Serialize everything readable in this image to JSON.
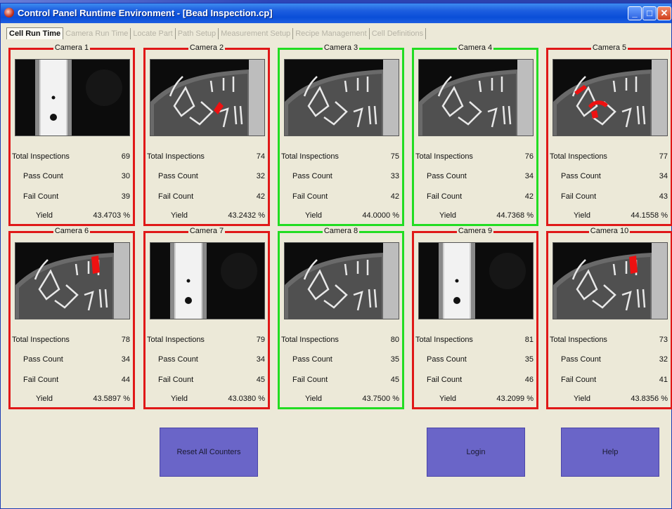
{
  "window": {
    "title": "Control Panel Runtime Environment - [Bead Inspection.cp]"
  },
  "tabs": [
    {
      "label": "Cell Run Time",
      "active": true
    },
    {
      "label": "Camera Run Time",
      "active": false
    },
    {
      "label": "Locate Part",
      "active": false
    },
    {
      "label": "Path Setup",
      "active": false
    },
    {
      "label": "Measurement Setup",
      "active": false
    },
    {
      "label": "Recipe Management",
      "active": false
    },
    {
      "label": "Cell Definitions",
      "active": false
    }
  ],
  "labels": {
    "total": "Total Inspections",
    "pass": "Pass Count",
    "fail": "Fail Count",
    "yield": "Yield"
  },
  "colors": {
    "fail_border": "#e01818",
    "pass_border": "#22dd22",
    "button": "#6a65c8",
    "titlebar": "#0a4ed8"
  },
  "cameras": [
    {
      "name": "Camera 1",
      "status": "fail",
      "image": "bracket",
      "total": "69",
      "pass": "30",
      "fail": "39",
      "yield": "43.4703  %"
    },
    {
      "name": "Camera 2",
      "status": "fail",
      "image": "bead-defect-1",
      "total": "74",
      "pass": "32",
      "fail": "42",
      "yield": "43.2432  %"
    },
    {
      "name": "Camera 3",
      "status": "pass",
      "image": "bead",
      "total": "75",
      "pass": "33",
      "fail": "42",
      "yield": "44.0000  %"
    },
    {
      "name": "Camera 4",
      "status": "pass",
      "image": "bead",
      "total": "76",
      "pass": "34",
      "fail": "42",
      "yield": "44.7368  %"
    },
    {
      "name": "Camera 5",
      "status": "fail",
      "image": "bead-defect-2",
      "total": "77",
      "pass": "34",
      "fail": "43",
      "yield": "44.1558  %"
    },
    {
      "name": "Camera 6",
      "status": "fail",
      "image": "bead-defect-3",
      "total": "78",
      "pass": "34",
      "fail": "44",
      "yield": "43.5897  %"
    },
    {
      "name": "Camera 7",
      "status": "fail",
      "image": "bracket",
      "total": "79",
      "pass": "34",
      "fail": "45",
      "yield": "43.0380  %"
    },
    {
      "name": "Camera 8",
      "status": "pass",
      "image": "bead",
      "total": "80",
      "pass": "35",
      "fail": "45",
      "yield": "43.7500  %"
    },
    {
      "name": "Camera 9",
      "status": "fail",
      "image": "bracket",
      "total": "81",
      "pass": "35",
      "fail": "46",
      "yield": "43.2099  %"
    },
    {
      "name": "Camera 10",
      "status": "fail",
      "image": "bead-defect-3",
      "total": "73",
      "pass": "32",
      "fail": "41",
      "yield": "43.8356  %"
    }
  ],
  "buttons": {
    "reset": "Reset All Counters",
    "login": "Login",
    "help": "Help"
  }
}
